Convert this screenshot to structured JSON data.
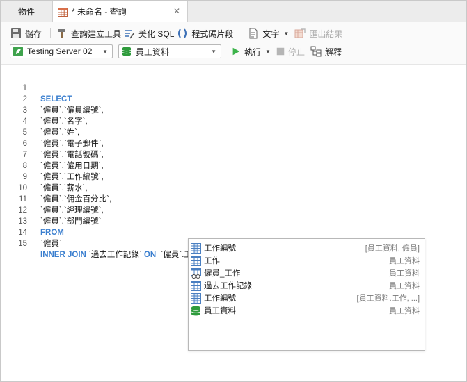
{
  "tabs": {
    "objects_label": "物件",
    "query_label": "* 未命名 - 查詢",
    "close_glyph": "✕"
  },
  "toolbar": {
    "save_label": "儲存",
    "query_builder_label": "查詢建立工具",
    "beautify_label": "美化 SQL",
    "snippet_label": "程式碼片段",
    "text_label": "文字",
    "export_label": "匯出結果",
    "server_value": "Testing Server 02",
    "database_value": "員工資料",
    "run_label": "執行",
    "stop_label": "停止",
    "explain_label": "解釋"
  },
  "colors": {
    "keyword": "#3b7fcf",
    "server_green": "#3fa34d",
    "run_green": "#3cb34a"
  },
  "editor": {
    "lines": [
      {
        "n": "1",
        "kw": "SELECT",
        "text": ""
      },
      {
        "n": "2",
        "kw": "",
        "text": "`僱員`.`僱員編號`,"
      },
      {
        "n": "3",
        "kw": "",
        "text": "`僱員`.`名字`,"
      },
      {
        "n": "4",
        "kw": "",
        "text": "`僱員`.`姓`,"
      },
      {
        "n": "5",
        "kw": "",
        "text": "`僱員`.`電子郵件`,"
      },
      {
        "n": "6",
        "kw": "",
        "text": "`僱員`.`電話號碼`,"
      },
      {
        "n": "7",
        "kw": "",
        "text": "`僱員`.`僱用日期`,"
      },
      {
        "n": "8",
        "kw": "",
        "text": "`僱員`.`工作編號`,"
      },
      {
        "n": "9",
        "kw": "",
        "text": "`僱員`.`薪水`,"
      },
      {
        "n": "10",
        "kw": "",
        "text": "`僱員`.`佣金百分比`,"
      },
      {
        "n": "11",
        "kw": "",
        "text": "`僱員`.`經理編號`,"
      },
      {
        "n": "12",
        "kw": "",
        "text": "`僱員`.`部門編號`"
      },
      {
        "n": "13",
        "kw": "FROM",
        "text": ""
      },
      {
        "n": "14",
        "kw": "",
        "text": "`僱員`"
      }
    ],
    "line15": {
      "n": "15",
      "kw1": "INNER JOIN",
      "t1": " `過去工作記錄` ",
      "kw2": "ON",
      "t2": "  `僱員`.工"
    }
  },
  "completion": {
    "items": [
      {
        "label": "工作編號",
        "info": "[員工資料, 僱員]",
        "icon": "column-icon"
      },
      {
        "label": "工作",
        "info": "員工資料",
        "icon": "table-icon"
      },
      {
        "label": "僱員_工作",
        "info": "員工資料",
        "icon": "view-icon"
      },
      {
        "label": "過去工作記錄",
        "info": "員工資料",
        "icon": "table-icon"
      },
      {
        "label": "工作編號",
        "info": "[員工資料.工作, ...]",
        "icon": "column-icon"
      },
      {
        "label": "員工資料",
        "info": "員工資料",
        "icon": "database-icon"
      }
    ]
  }
}
